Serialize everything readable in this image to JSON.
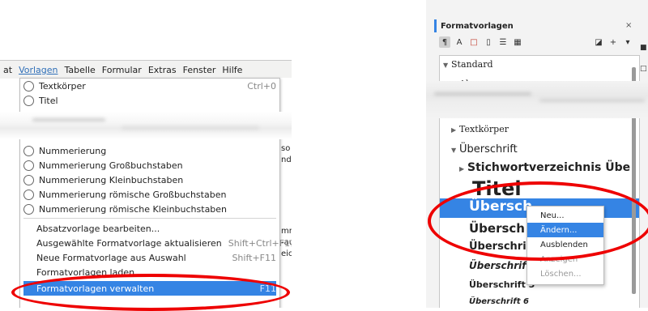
{
  "left": {
    "menubar": {
      "items": [
        "at",
        "Vorlagen",
        "Tabelle",
        "Formular",
        "Extras",
        "Fenster",
        "Hilfe"
      ]
    },
    "menu_top": [
      {
        "label": "Textkörper",
        "shortcut": "Ctrl+0"
      },
      {
        "label": "Titel",
        "shortcut": ""
      }
    ],
    "menu_list": [
      "Nummerierung",
      "Nummerierung Großbuchstaben",
      "Nummerierung Kleinbuchstaben",
      "Nummerierung römische Großbuchstaben",
      "Nummerierung römische Kleinbuchstaben"
    ],
    "menu_actions": [
      {
        "label": "Absatzvorlage bearbeiten...",
        "shortcut": ""
      },
      {
        "label": "Ausgewählte Formatvorlage aktualisieren",
        "shortcut": "Shift+Ctrl+F11"
      },
      {
        "label": "Neue Formatvorlage aus Auswahl",
        "shortcut": "Shift+F11"
      },
      {
        "label": "Formatvorlagen laden...",
        "shortcut": ""
      },
      {
        "label": "Formatvorlagen verwalten",
        "shortcut": "F11"
      }
    ],
    "doc_edge": [
      "so",
      "nd",
      "mm",
      "-au",
      "eich"
    ]
  },
  "right": {
    "sidebar_title": "Formatvorlagen",
    "close_symbol": "×",
    "toolbar_icons": [
      "paragraph-styles-icon",
      "character-styles-icon",
      "frame-styles-icon",
      "page-styles-icon",
      "list-styles-icon",
      "table-styles-icon"
    ],
    "tree": {
      "standard": "Standard",
      "absent": "Absen",
      "textkoerper": "Textkörper",
      "ueberschrift": "Überschrift",
      "stichwort": "Stichwortverzeichnis Übe",
      "titel": "Titel",
      "ueb1": "Übersch",
      "ueb2": "Übersch",
      "ueb3": "Überschri",
      "ueb4": "Überschrif",
      "ueb5": "Überschrift 5",
      "ueb6": "Überschrift 6"
    },
    "context_menu": [
      "Neu...",
      "Ändern...",
      "Ausblenden",
      "Anzeigen",
      "Löschen..."
    ]
  },
  "colors": {
    "accent": "#3584e4",
    "annotation": "#e00000"
  }
}
